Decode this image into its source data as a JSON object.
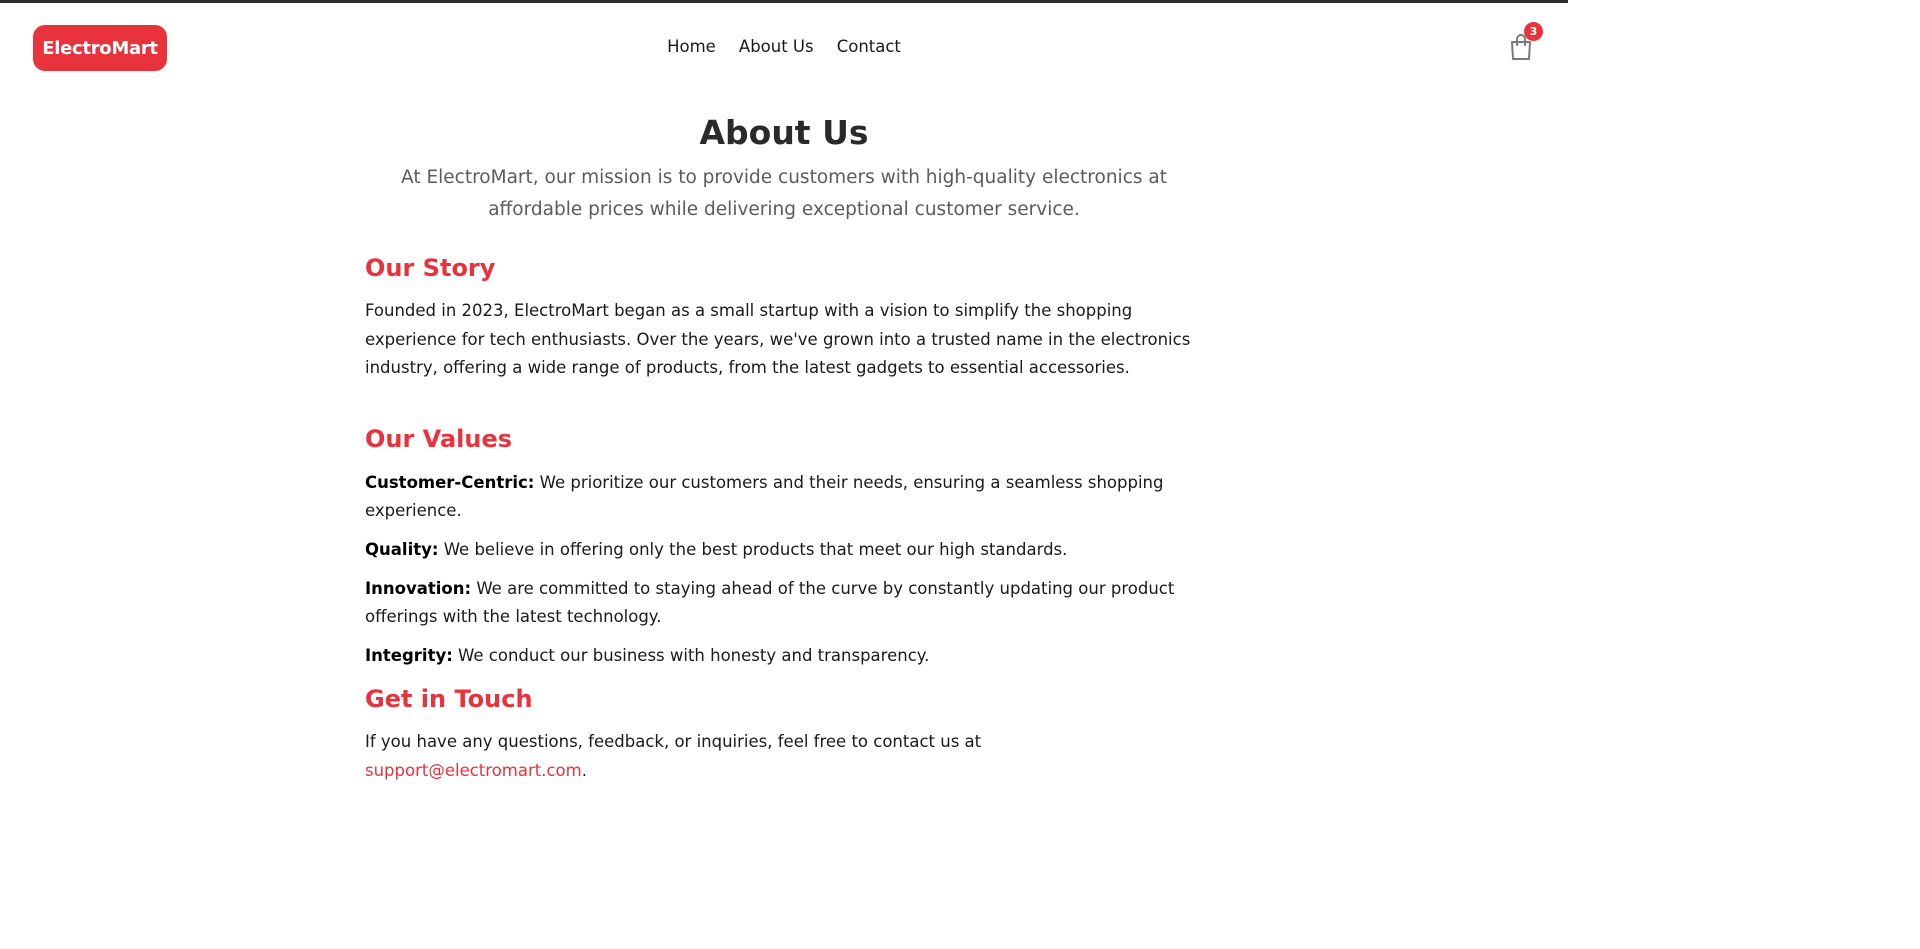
{
  "header": {
    "logo": "ElectroMart",
    "nav": [
      "Home",
      "About Us",
      "Contact"
    ],
    "cart_count": "3"
  },
  "page": {
    "title": "About Us",
    "mission": "At ElectroMart, our mission is to provide customers with high-quality electronics at affordable prices while delivering exceptional customer service."
  },
  "story": {
    "heading": "Our Story",
    "text": "Founded in 2023, ElectroMart began as a small startup with a vision to simplify the shopping experience for tech enthusiasts. Over the years, we've grown into a trusted name in the electronics industry, offering a wide range of products, from the latest gadgets to essential accessories."
  },
  "values": {
    "heading": "Our Values",
    "items": [
      {
        "label": "Customer-Centric:",
        "text": " We prioritize our customers and their needs, ensuring a seamless shopping experience."
      },
      {
        "label": "Quality:",
        "text": " We believe in offering only the best products that meet our high standards."
      },
      {
        "label": "Innovation:",
        "text": " We are committed to staying ahead of the curve by constantly updating our product offerings with the latest technology."
      },
      {
        "label": "Integrity:",
        "text": " We conduct our business with honesty and transparency."
      }
    ]
  },
  "touch": {
    "heading": "Get in Touch",
    "text": "If you have any questions, feedback, or inquiries, feel free to contact us at ",
    "email": "support@electromart.com",
    "suffix": "."
  },
  "colors": {
    "accent": "#e8323c",
    "text": "#1a1a1a",
    "muted": "#5b5b5b"
  },
  "icons": {
    "cart": "shopping-bag-icon"
  }
}
